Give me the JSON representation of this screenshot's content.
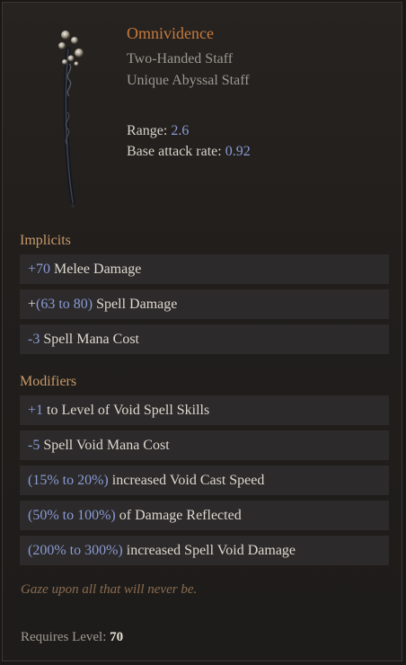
{
  "item": {
    "name": "Omnividence",
    "type_line": "Two-Handed Staff",
    "base_line": "Unique Abyssal Staff"
  },
  "stats": {
    "range_label": "Range:",
    "range_value": "2.6",
    "attack_rate_label": "Base attack rate:",
    "attack_rate_value": "0.92"
  },
  "implicits": {
    "heading": "Implicits",
    "rows": [
      {
        "value": "+70",
        "text": " Melee Damage",
        "prefix": ""
      },
      {
        "prefix": "+",
        "value": "(63 to 80)",
        "text": " Spell Damage"
      },
      {
        "prefix": "",
        "value": "-3",
        "text": " Spell Mana Cost"
      }
    ]
  },
  "modifiers": {
    "heading": "Modifiers",
    "rows": [
      {
        "value": "+1",
        "text": " to Level of Void Spell Skills"
      },
      {
        "value": "-5",
        "text": " Spell Void Mana Cost"
      },
      {
        "value": "(15% to 20%)",
        "text": " increased Void Cast Speed"
      },
      {
        "value": "(50% to 100%)",
        "text": " of Damage Reflected"
      },
      {
        "value": "(200% to 300%)",
        "text": " increased Spell Void Damage"
      }
    ]
  },
  "flavor_text": "Gaze upon all that will never be.",
  "requirement": {
    "label": "Requires Level: ",
    "level": "70"
  },
  "icons": {
    "item_art": "abyssal-staff-icon"
  },
  "colors": {
    "unique_name": "#c77a3c",
    "value_blue": "#8a9bd6",
    "section_heading": "#c89a6a",
    "flavor": "#8a6b50"
  }
}
